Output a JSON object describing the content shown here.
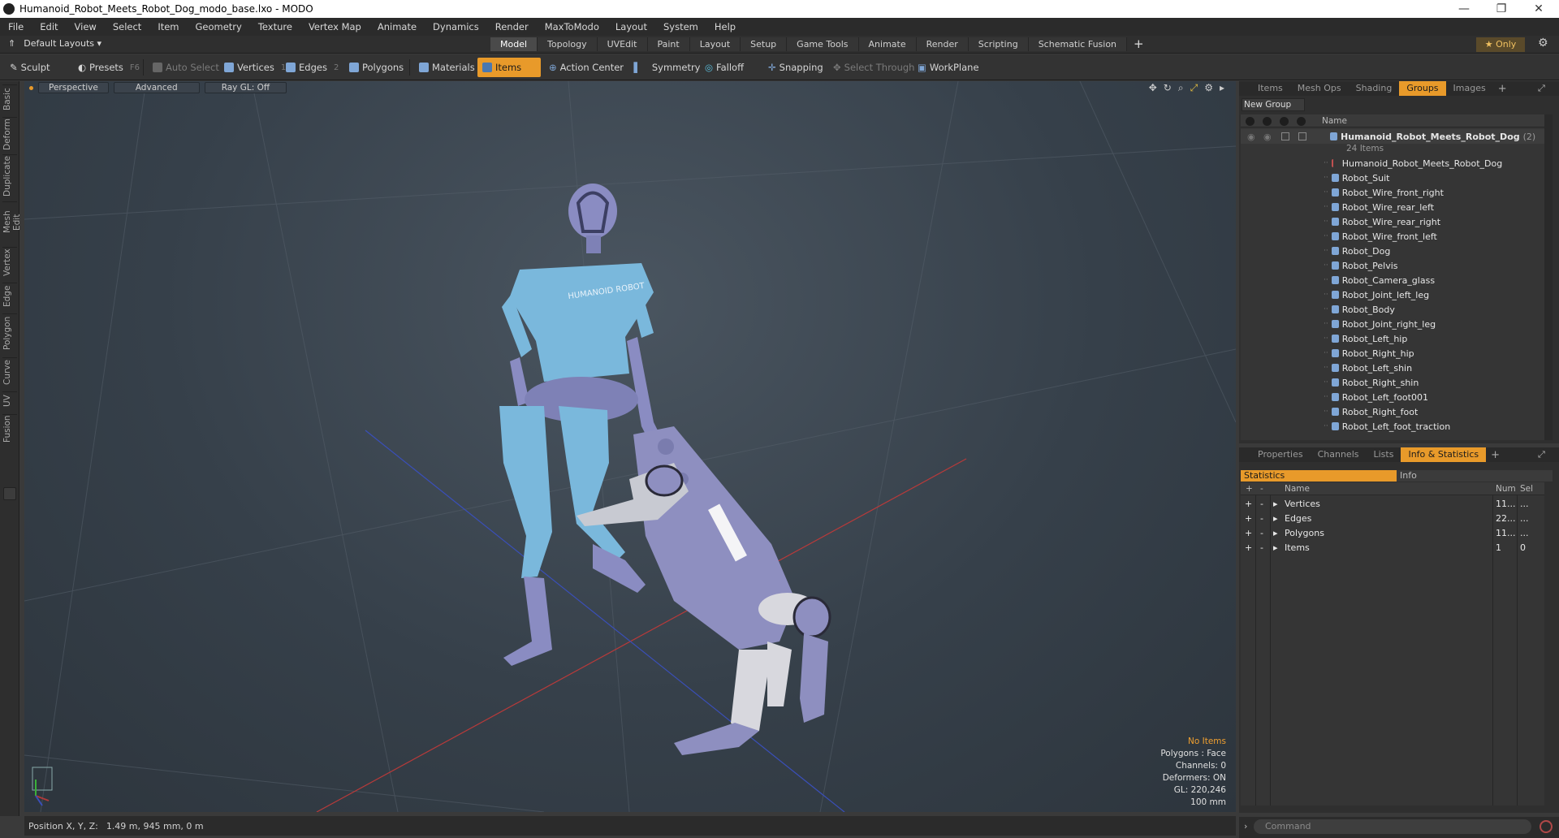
{
  "window": {
    "title": "Humanoid_Robot_Meets_Robot_Dog_modo_base.lxo - MODO"
  },
  "menu": [
    "File",
    "Edit",
    "View",
    "Select",
    "Item",
    "Geometry",
    "Texture",
    "Vertex Map",
    "Animate",
    "Dynamics",
    "Render",
    "MaxToModo",
    "Layout",
    "System",
    "Help"
  ],
  "layout": {
    "selector": "Default Layouts ▾",
    "only": "★  Only"
  },
  "workspace_tabs": [
    "Model",
    "Topology",
    "UVEdit",
    "Paint",
    "Layout",
    "Setup",
    "Game Tools",
    "Animate",
    "Render",
    "Scripting",
    "Schematic Fusion"
  ],
  "active_workspace": "Model",
  "toolbar": {
    "sculpt": "Sculpt",
    "presets": "Presets",
    "presets_key": "F6",
    "auto_select": "Auto Select",
    "vertices": "Vertices",
    "vertices_num": "1",
    "edges": "Edges",
    "edges_num": "2",
    "polygons": "Polygons",
    "materials": "Materials",
    "items": "Items",
    "action_center": "Action Center",
    "symmetry": "Symmetry",
    "falloff": "Falloff",
    "snapping": "Snapping",
    "select_through": "Select Through",
    "workplane": "WorkPlane"
  },
  "left_tabs": [
    "Basic",
    "Deform",
    "Duplicate",
    "Mesh Edit",
    "Vertex",
    "Edge",
    "Polygon",
    "Curve",
    "UV",
    "Fusion"
  ],
  "viewport": {
    "view": "Perspective",
    "mode": "Advanced",
    "raygl": "Ray GL: Off",
    "robot_shirt_text": "HUMANOID ROBOT",
    "info": {
      "no_items": "No Items",
      "polygons": "Polygons : Face",
      "channels": "Channels: 0",
      "deformers": "Deformers: ON",
      "gl": "GL: 220,246",
      "scale": "100 mm"
    }
  },
  "status": {
    "position_label": "Position X, Y, Z:",
    "position_value": "1.49 m, 945 mm, 0 m"
  },
  "top_panel": {
    "tabs": [
      "Items",
      "Mesh Ops",
      "Shading",
      "Groups",
      "Images"
    ],
    "active": "Groups",
    "new_group": "New Group",
    "name_header": "Name",
    "group_name": "Humanoid_Robot_Meets_Robot_Dog",
    "group_count": "(2)",
    "group_items": "24 Items",
    "items": [
      "Humanoid_Robot_Meets_Robot_Dog",
      "Robot_Suit",
      "Robot_Wire_front_right",
      "Robot_Wire_rear_left",
      "Robot_Wire_rear_right",
      "Robot_Wire_front_left",
      "Robot_Dog",
      "Robot_Pelvis",
      "Robot_Camera_glass",
      "Robot_Joint_left_leg",
      "Robot_Body",
      "Robot_Joint_right_leg",
      "Robot_Left_hip",
      "Robot_Right_hip",
      "Robot_Left_shin",
      "Robot_Right_shin",
      "Robot_Left_foot001",
      "Robot_Right_foot",
      "Robot_Left_foot_traction"
    ]
  },
  "bottom_panel": {
    "tabs": [
      "Properties",
      "Channels",
      "Lists",
      "Info & Statistics"
    ],
    "active": "Info & Statistics",
    "subtabs": [
      "Statistics",
      "Info"
    ],
    "headers": {
      "add": "+",
      "minus": "-",
      "name": "Name",
      "num": "Num",
      "sel": "Sel"
    },
    "rows": [
      {
        "name": "Vertices",
        "num": "11...",
        "sel": "..."
      },
      {
        "name": "Edges",
        "num": "22...",
        "sel": "..."
      },
      {
        "name": "Polygons",
        "num": "11...",
        "sel": "..."
      },
      {
        "name": "Items",
        "num": "1",
        "sel": "0"
      }
    ]
  },
  "command": {
    "placeholder": "Command"
  },
  "colors": {
    "accent": "#e89a2a",
    "shirt": "#7ab8dc",
    "robot": "#8e8fc0"
  }
}
